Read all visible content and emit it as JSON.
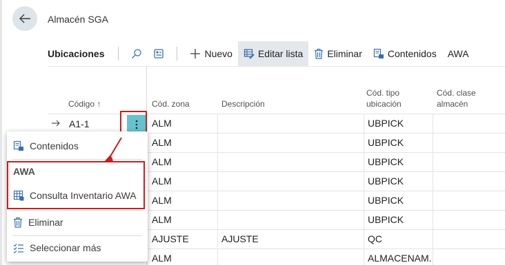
{
  "header": {
    "back_label": "Atrás",
    "page_caption": "Almacén SGA"
  },
  "toolbar": {
    "title": "Ubicaciones",
    "new_label": "Nuevo",
    "edit_list_label": "Editar lista",
    "delete_label": "Eliminar",
    "contents_label": "Contenidos",
    "awa_label": "AWA"
  },
  "columns": {
    "code": "Código ↑",
    "zone": "Cód. zona",
    "description": "Descripción",
    "bin_type_1": "Cód. tipo",
    "bin_type_2": "ubicación",
    "warehouse_class_1": "Cód. clase",
    "warehouse_class_2": "almacén"
  },
  "rows": [
    {
      "code": "A1-1",
      "zone": "ALM",
      "description": "",
      "bin_type": "UBPICK"
    },
    {
      "code": "",
      "zone": "ALM",
      "description": "",
      "bin_type": "UBPICK"
    },
    {
      "code": "",
      "zone": "ALM",
      "description": "",
      "bin_type": "UBPICK"
    },
    {
      "code": "",
      "zone": "ALM",
      "description": "",
      "bin_type": "UBPICK"
    },
    {
      "code": "",
      "zone": "ALM",
      "description": "",
      "bin_type": "UBPICK"
    },
    {
      "code": "",
      "zone": "ALM",
      "description": "",
      "bin_type": "UBPICK"
    },
    {
      "code": "",
      "zone": "AJUSTE",
      "description": "AJUSTE",
      "bin_type": "QC"
    },
    {
      "code": "",
      "zone": "ALM",
      "description": "",
      "bin_type": "ALMACENAM."
    }
  ],
  "context_menu": {
    "contents_label": "Contenidos",
    "group_label": "AWA",
    "awa_inventory_label": "Consulta Inventario AWA",
    "delete_label": "Eliminar",
    "select_more_label": "Seleccionar más"
  },
  "colors": {
    "accent": "#64c3cf",
    "highlight": "#d11a1a",
    "icon_blue": "#3a6fb0"
  }
}
